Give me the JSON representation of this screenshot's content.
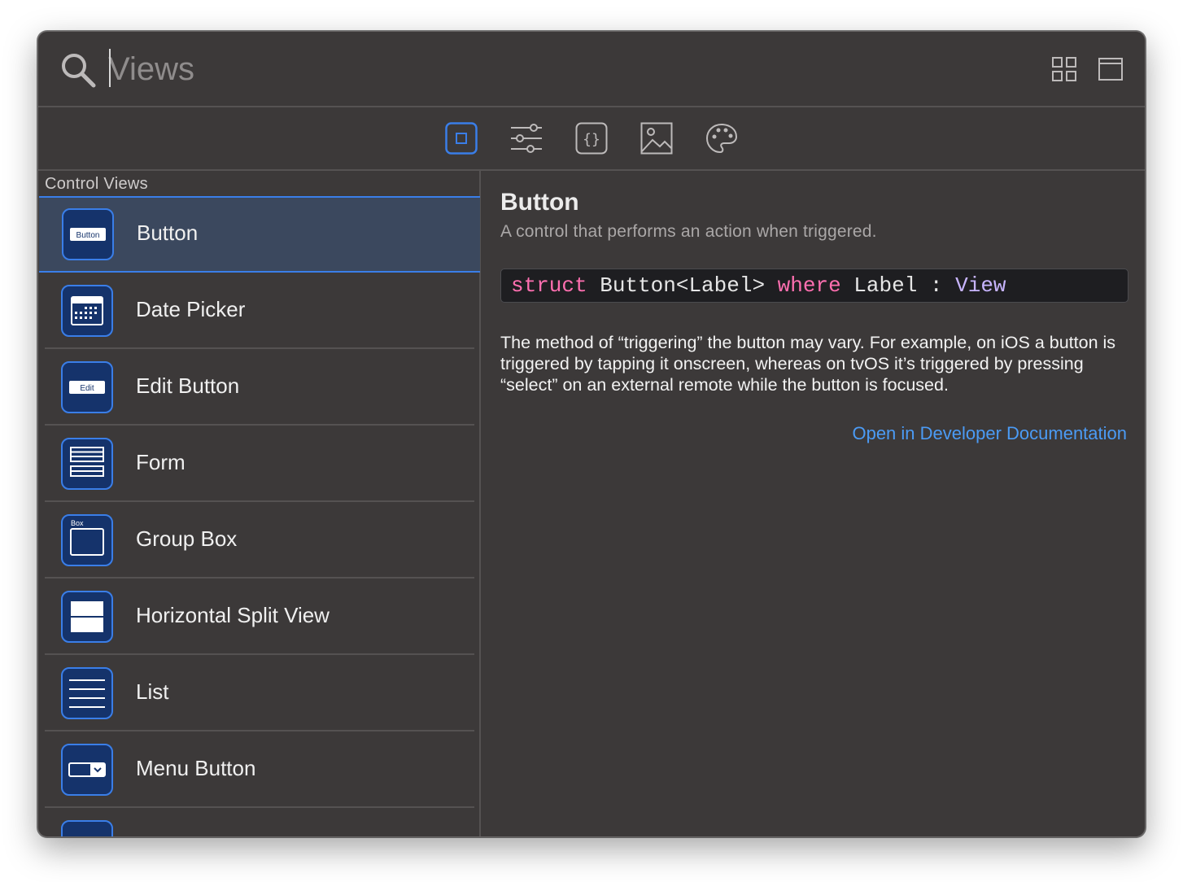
{
  "search": {
    "placeholder": "Views",
    "value": ""
  },
  "toolbar": {
    "grid_view_icon": "grid-icon",
    "single_view_icon": "single-column-icon"
  },
  "categories": [
    {
      "icon": "views-icon",
      "selected": true
    },
    {
      "icon": "modifiers-icon",
      "selected": false
    },
    {
      "icon": "snippets-icon",
      "selected": false
    },
    {
      "icon": "image-icon",
      "selected": false
    },
    {
      "icon": "color-palette-icon",
      "selected": false
    }
  ],
  "section": {
    "title": "Control Views"
  },
  "items": [
    {
      "label": "Button",
      "tile_text": "Button",
      "icon": "button-tile-icon",
      "selected": true
    },
    {
      "label": "Date Picker",
      "icon": "calendar-tile-icon",
      "selected": false
    },
    {
      "label": "Edit Button",
      "tile_text": "Edit",
      "icon": "edit-button-tile-icon",
      "selected": false
    },
    {
      "label": "Form",
      "icon": "form-tile-icon",
      "selected": false
    },
    {
      "label": "Group Box",
      "tile_text": "Box",
      "icon": "group-box-tile-icon",
      "selected": false
    },
    {
      "label": "Horizontal Split View",
      "icon": "horizontal-split-tile-icon",
      "selected": false
    },
    {
      "label": "List",
      "icon": "list-tile-icon",
      "selected": false
    },
    {
      "label": "Menu Button",
      "icon": "menu-button-tile-icon",
      "selected": false
    }
  ],
  "detail": {
    "title": "Button",
    "subtitle": "A control that performs an action when triggered.",
    "declaration": {
      "kw1": "struct",
      "name": " Button<Label> ",
      "kw2": "where",
      "constraint": " Label : ",
      "type": "View"
    },
    "description": "The method of “triggering” the button may vary. For example, on iOS a button is triggered by tapping it onscreen, whereas on tvOS it’s triggered by pressing “select” on an external remote while the button is focused.",
    "link": "Open in Developer Documentation"
  },
  "colors": {
    "accent": "#3a7ee8",
    "link": "#4b9bf5",
    "keyword": "#ff6fb0",
    "type": "#c8b5ff"
  }
}
